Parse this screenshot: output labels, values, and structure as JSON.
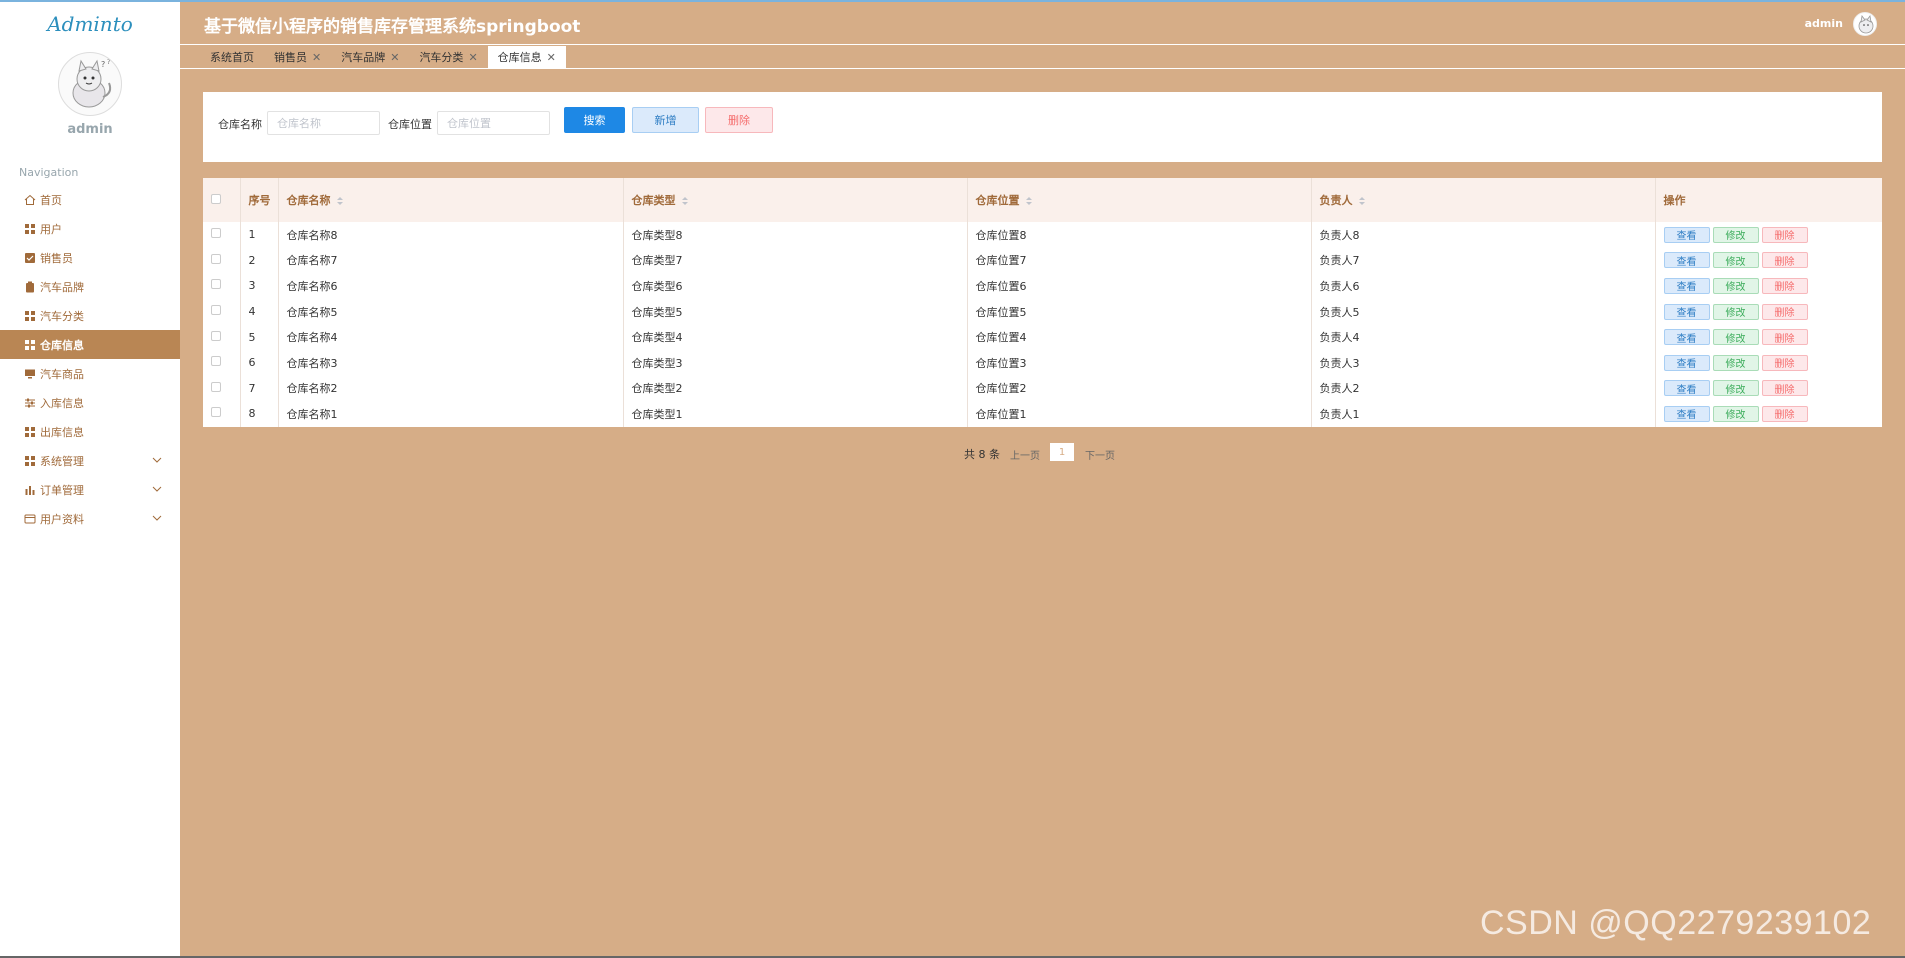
{
  "app": {
    "logo": "Adminto",
    "title": "基于微信小程序的销售库存管理系统springboot",
    "user": "admin"
  },
  "sidebar": {
    "username": "admin",
    "nav_title": "Navigation",
    "items": [
      {
        "label": "首页",
        "icon": "home-icon"
      },
      {
        "label": "用户",
        "icon": "grid-icon"
      },
      {
        "label": "销售员",
        "icon": "check-square-icon"
      },
      {
        "label": "汽车品牌",
        "icon": "clipboard-icon"
      },
      {
        "label": "汽车分类",
        "icon": "grid-icon"
      },
      {
        "label": "仓库信息",
        "icon": "grid-icon"
      },
      {
        "label": "汽车商品",
        "icon": "monitor-icon"
      },
      {
        "label": "入库信息",
        "icon": "sliders-icon"
      },
      {
        "label": "出库信息",
        "icon": "grid-icon"
      },
      {
        "label": "系统管理",
        "icon": "grid-icon"
      },
      {
        "label": "订单管理",
        "icon": "bar-chart-icon"
      },
      {
        "label": "用户资料",
        "icon": "id-card-icon"
      }
    ],
    "active_index": 5
  },
  "tabs": [
    {
      "label": "系统首页",
      "closable": false
    },
    {
      "label": "销售员",
      "closable": true
    },
    {
      "label": "汽车品牌",
      "closable": true
    },
    {
      "label": "汽车分类",
      "closable": true
    },
    {
      "label": "仓库信息",
      "closable": true
    }
  ],
  "search": {
    "name_label": "仓库名称",
    "name_placeholder": "仓库名称",
    "location_label": "仓库位置",
    "location_placeholder": "仓库位置",
    "search_button": "搜索",
    "add_button": "新增",
    "delete_button": "删除"
  },
  "table": {
    "headers": {
      "index": "序号",
      "name": "仓库名称",
      "type": "仓库类型",
      "location": "仓库位置",
      "manager": "负责人",
      "actions": "操作"
    },
    "rows": [
      {
        "index": "1",
        "name": "仓库名称8",
        "type": "仓库类型8",
        "location": "仓库位置8",
        "manager": "负责人8"
      },
      {
        "index": "2",
        "name": "仓库名称7",
        "type": "仓库类型7",
        "location": "仓库位置7",
        "manager": "负责人7"
      },
      {
        "index": "3",
        "name": "仓库名称6",
        "type": "仓库类型6",
        "location": "仓库位置6",
        "manager": "负责人6"
      },
      {
        "index": "4",
        "name": "仓库名称5",
        "type": "仓库类型5",
        "location": "仓库位置5",
        "manager": "负责人5"
      },
      {
        "index": "5",
        "name": "仓库名称4",
        "type": "仓库类型4",
        "location": "仓库位置4",
        "manager": "负责人4"
      },
      {
        "index": "6",
        "name": "仓库名称3",
        "type": "仓库类型3",
        "location": "仓库位置3",
        "manager": "负责人3"
      },
      {
        "index": "7",
        "name": "仓库名称2",
        "type": "仓库类型2",
        "location": "仓库位置2",
        "manager": "负责人2"
      },
      {
        "index": "8",
        "name": "仓库名称1",
        "type": "仓库类型1",
        "location": "仓库位置1",
        "manager": "负责人1"
      }
    ],
    "actions": {
      "view": "查看",
      "edit": "修改",
      "delete": "删除"
    }
  },
  "pagination": {
    "total": "共 8 条",
    "prev": "上一页",
    "current": "1",
    "next": "下一页"
  },
  "watermark": "CSDN @QQ2279239102",
  "colors": {
    "background": "#d6ad87",
    "active_nav": "#b98654",
    "primary": "#1e88e5"
  }
}
